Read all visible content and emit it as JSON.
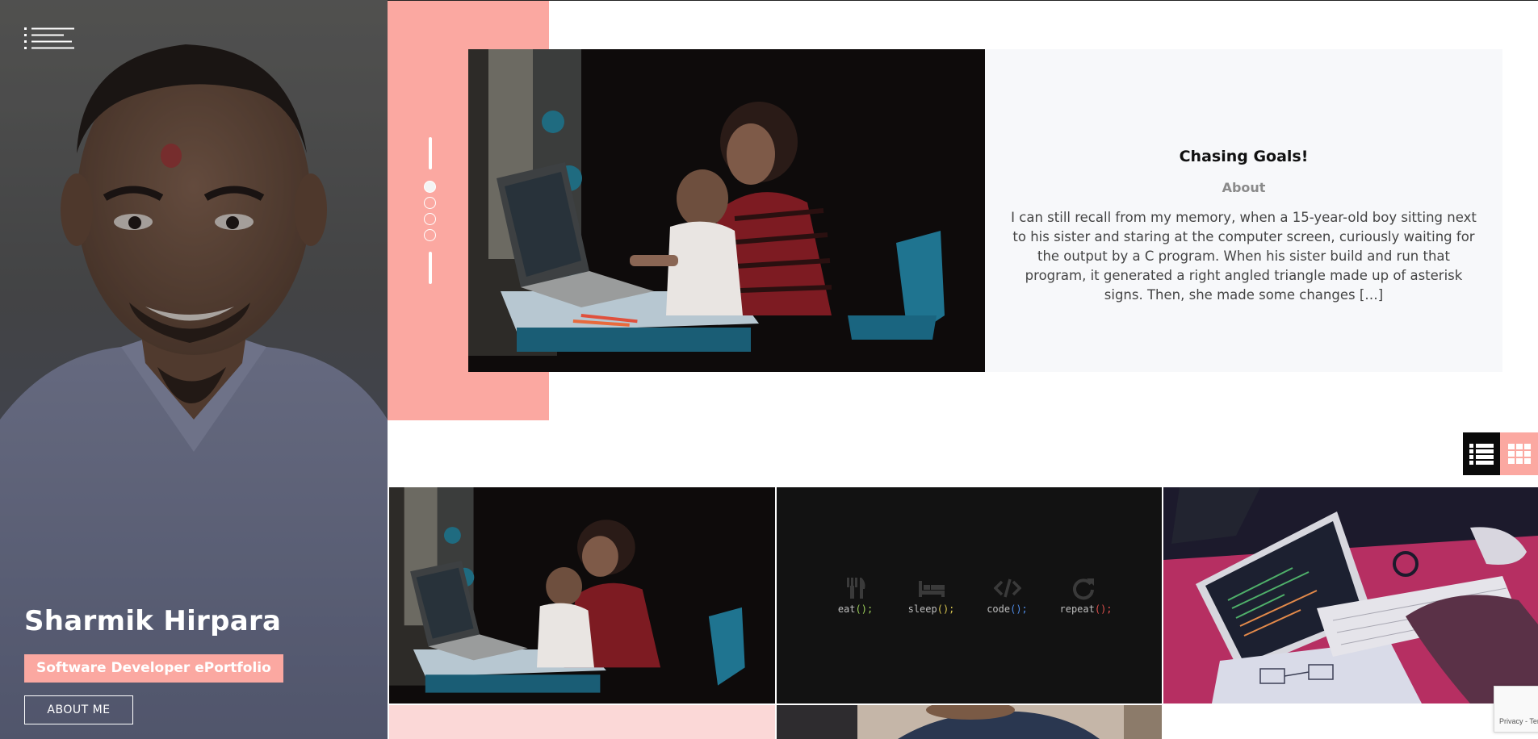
{
  "profile": {
    "name": "Sharmik Hirpara",
    "tagline": "Software Developer ePortfolio",
    "about_button": "ABOUT ME",
    "accent_color": "#fba8a1"
  },
  "featured": {
    "title": "Chasing Goals!",
    "category": "About",
    "excerpt": "I can still recall from my memory, when a 15-year-old boy sitting next to his sister and staring at the computer screen, curiously waiting for the output by a C program. When his sister build and run that program, it generated a right angled triangle made up of asterisk signs. Then, she made some changes […]",
    "slide_count": 4,
    "active_slide": 1
  },
  "view_toggle": {
    "active": "list",
    "icons": [
      "list-view-icon",
      "grid-view-icon"
    ]
  },
  "grid": {
    "tile2_words": [
      {
        "icon": "fork-knife-icon",
        "word": "eat",
        "parens": "();"
      },
      {
        "icon": "bed-icon",
        "word": "sleep",
        "parens": "();"
      },
      {
        "icon": "code-icon",
        "word": "code",
        "parens": "();"
      },
      {
        "icon": "refresh-icon",
        "word": "repeat",
        "parens": "();"
      }
    ]
  },
  "recaptcha": {
    "text": "Privacy - Terms"
  }
}
